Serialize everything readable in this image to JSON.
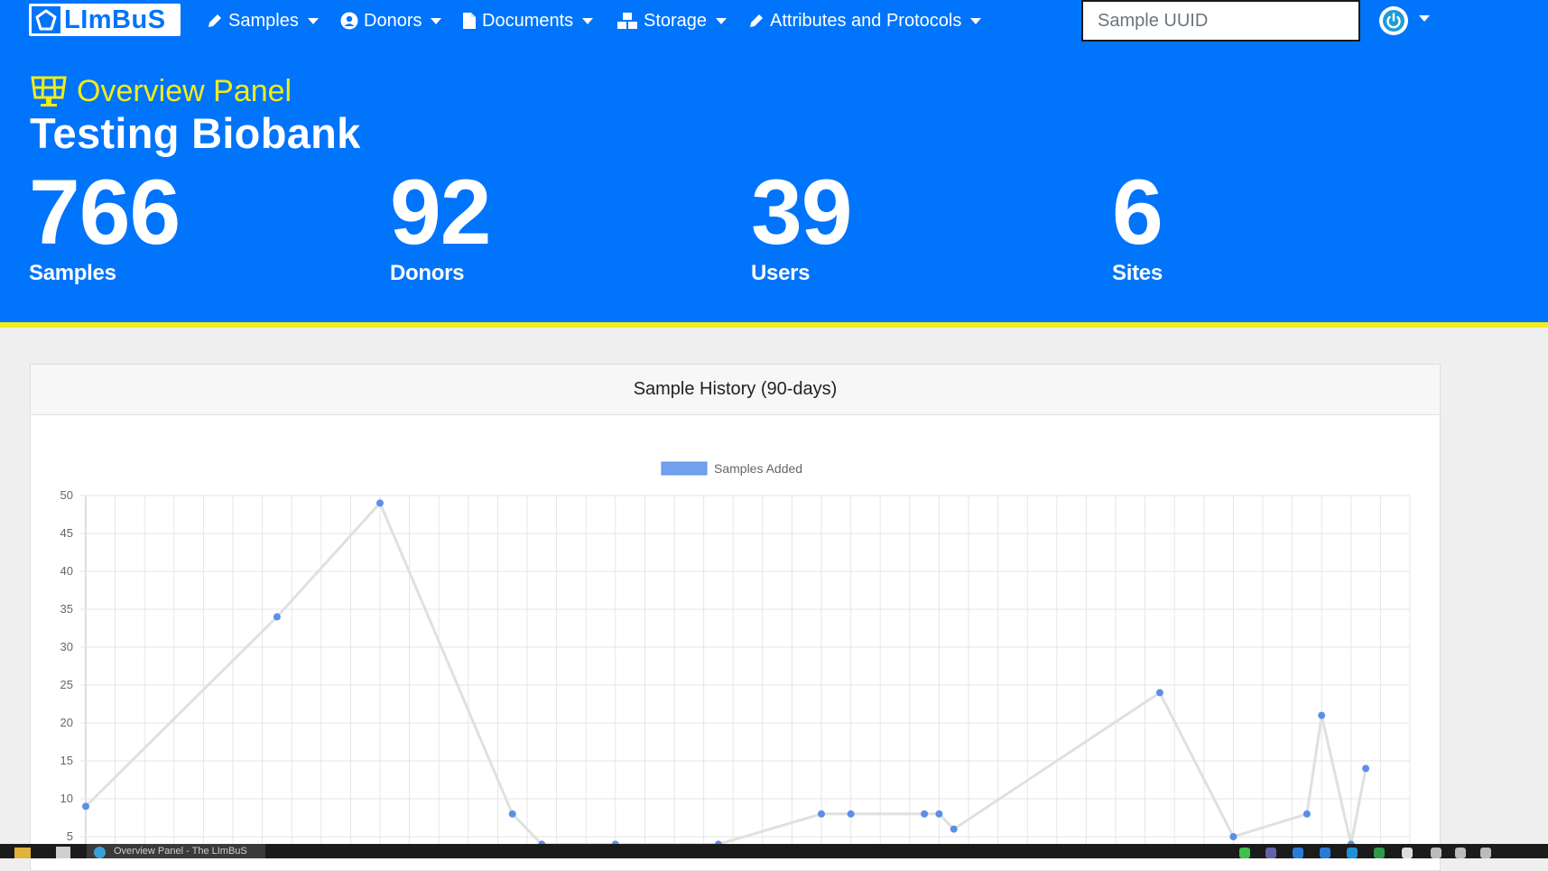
{
  "brand": {
    "name": "LImBuS"
  },
  "nav": {
    "items": [
      {
        "label": "Samples",
        "icon": "pencil-icon"
      },
      {
        "label": "Donors",
        "icon": "user-circle-icon"
      },
      {
        "label": "Documents",
        "icon": "file-icon"
      },
      {
        "label": "Storage",
        "icon": "boxes-icon"
      },
      {
        "label": "Attributes and Protocols",
        "icon": "pencil-icon"
      }
    ],
    "search_placeholder": "Sample UUID",
    "user_menu_icon": "power-icon"
  },
  "hero": {
    "panel_title": "Overview Panel",
    "panel_icon": "solar-panel-icon",
    "biobank_name": "Testing Biobank",
    "stats": [
      {
        "value": "766",
        "label": "Samples"
      },
      {
        "value": "92",
        "label": "Donors"
      },
      {
        "value": "39",
        "label": "Users"
      },
      {
        "value": "6",
        "label": "Sites"
      }
    ]
  },
  "card": {
    "title": "Sample History (90-days)"
  },
  "chart_data": {
    "type": "line",
    "legend": {
      "label": "Samples Added",
      "position": "top"
    },
    "ylim": [
      5,
      50
    ],
    "yticks": [
      5,
      10,
      15,
      20,
      25,
      30,
      35,
      40,
      45,
      50
    ],
    "x_count": 45,
    "grid": true,
    "line_color": "#e0e0e0",
    "point_color": "#5b8fe6",
    "legend_color": "#70a0f0",
    "points": [
      {
        "x": 0,
        "y": 9
      },
      {
        "x": 6.5,
        "y": 34
      },
      {
        "x": 10,
        "y": 49
      },
      {
        "x": 14.5,
        "y": 8
      },
      {
        "x": 15.5,
        "y": 4
      },
      {
        "x": 18,
        "y": 4
      },
      {
        "x": 21.5,
        "y": 4
      },
      {
        "x": 25,
        "y": 8
      },
      {
        "x": 26,
        "y": 8
      },
      {
        "x": 28.5,
        "y": 8
      },
      {
        "x": 29,
        "y": 8
      },
      {
        "x": 29.5,
        "y": 6
      },
      {
        "x": 36.5,
        "y": 24
      },
      {
        "x": 39,
        "y": 5
      },
      {
        "x": 41.5,
        "y": 8
      },
      {
        "x": 42,
        "y": 21
      },
      {
        "x": 43,
        "y": 4
      },
      {
        "x": 43.5,
        "y": 14
      }
    ]
  },
  "taskbar": {
    "active_window": "Overview Panel - The LImBuS"
  }
}
